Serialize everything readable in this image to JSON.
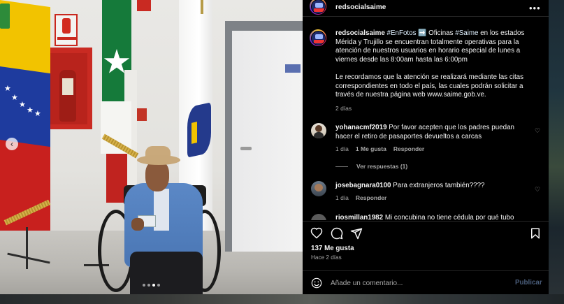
{
  "post": {
    "author": "redsocialsaime",
    "caption": {
      "author": "redsocialsaime",
      "hashtag_1": "#EnFotos",
      "arrow": "➡️",
      "p1_a": " Oficinas ",
      "hashtag_2": "#Saime",
      "p1_b": " en los estados Mérida y Trujillo se encuentran totalmente operativas para la atención de nuestros usuarios en horario especial de lunes a viernes desde las 8:00am hasta las 6:00pm",
      "p2": "Le recordamos que la atención se realizará mediante las citas correspondientes en todo el país, las cuales podrán solicitar a través de nuestra página web www.saime.gob.ve.",
      "time": "2 días"
    },
    "comments": [
      {
        "user": "yohanacmf2019",
        "text": "Por favor acepten que los padres puedan hacer el retiro de pasaportes devueltos a carcas",
        "time": "1 día",
        "likes": "1 Me gusta",
        "reply": "Responder",
        "view_replies": "Ver respuestas (1)"
      },
      {
        "user": "josebagnara0100",
        "text": "Para extranjeros también????",
        "time": "1 día",
        "reply": "Responder"
      },
      {
        "user": "riosmillan1982",
        "text": "Mi concubina no tiene cédula por qué tubo"
      }
    ],
    "likes_count": "137 Me gusta",
    "posted_ago": "Hace 2 días",
    "add_comment_placeholder": "Añade un comentario...",
    "publish_label": "Publicar"
  },
  "icons": {
    "more": "more-options-icon",
    "like": "heart-icon",
    "comment": "comment-icon",
    "share": "send-icon",
    "save": "bookmark-icon",
    "emoji": "emoji-icon",
    "prev": "chevron-left-icon"
  },
  "carousel": {
    "total": 4,
    "active": 3
  },
  "colors": {
    "panel_bg": "#000000",
    "text": "#f5f5f5",
    "muted": "#a8a8a8",
    "publish_disabled": "#4a5d7a"
  }
}
